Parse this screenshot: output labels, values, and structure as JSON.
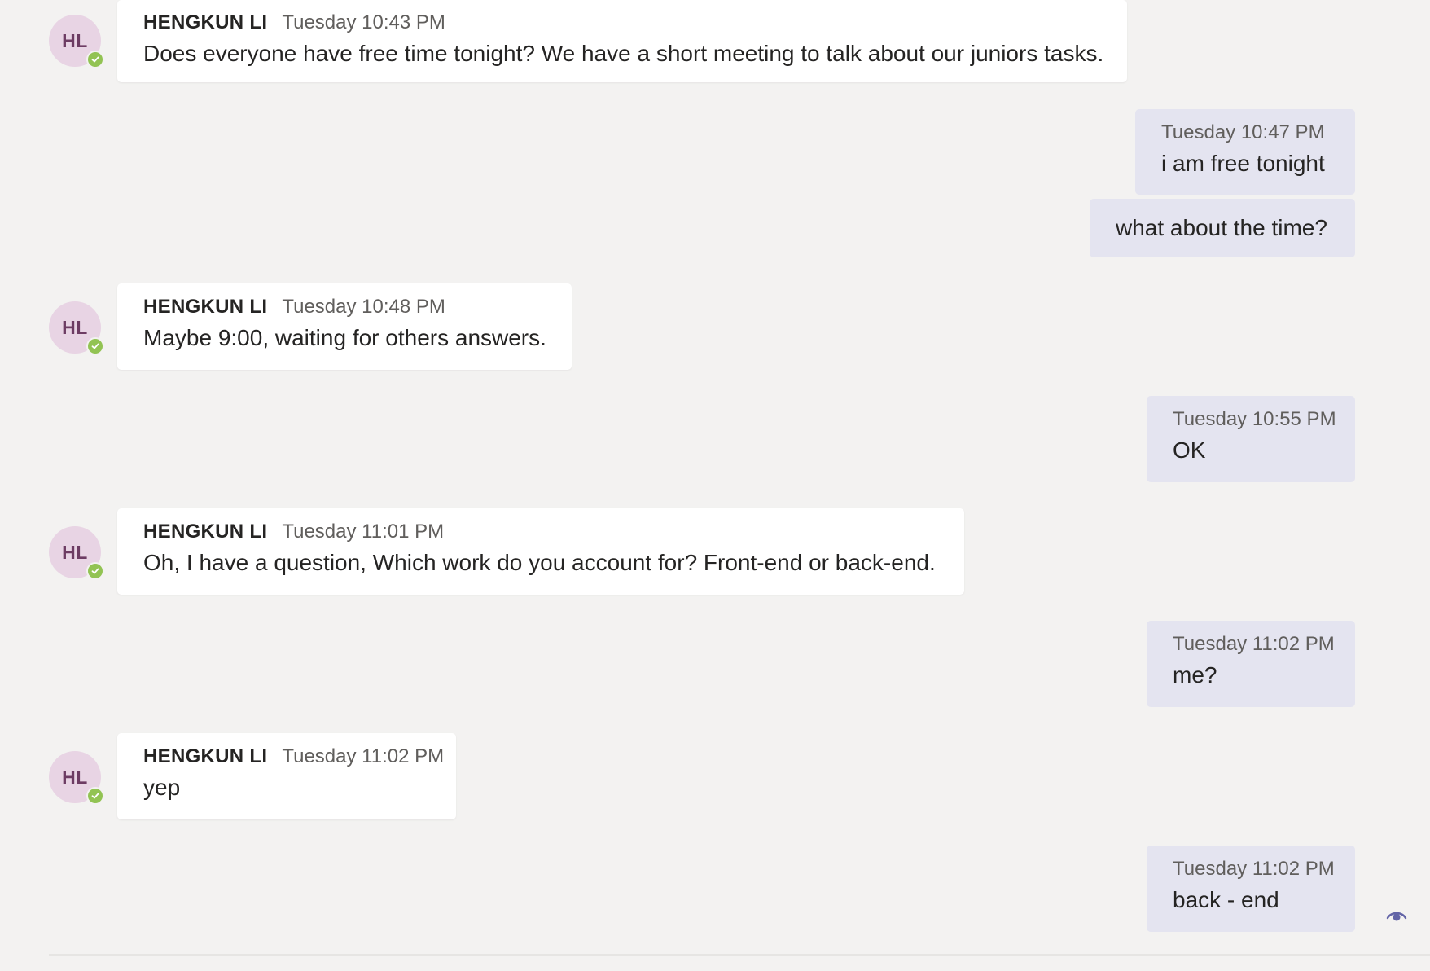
{
  "thread": {
    "messages": [
      {
        "direction": "incoming",
        "avatar_initials": "HL",
        "author": "HENGKUN LI",
        "time": "Tuesday 10:43 PM",
        "text": "Does everyone have free time tonight? We have a short meeting to talk about our juniors tasks."
      },
      {
        "direction": "outgoing",
        "time": "Tuesday 10:47 PM",
        "text": "i am free tonight"
      },
      {
        "direction": "outgoing",
        "time": "",
        "text": "what about the time?"
      },
      {
        "direction": "incoming",
        "avatar_initials": "HL",
        "author": "HENGKUN LI",
        "time": "Tuesday 10:48 PM",
        "text": "Maybe 9:00, waiting for others answers."
      },
      {
        "direction": "outgoing",
        "time": "Tuesday 10:55 PM",
        "text": "OK"
      },
      {
        "direction": "incoming",
        "avatar_initials": "HL",
        "author": "HENGKUN LI",
        "time": "Tuesday 11:01 PM",
        "text": "Oh, I have a question, Which work do you account for? Front-end or back-end."
      },
      {
        "direction": "outgoing",
        "time": "Tuesday 11:02 PM",
        "text": "me?"
      },
      {
        "direction": "incoming",
        "avatar_initials": "HL",
        "author": "HENGKUN LI",
        "time": "Tuesday 11:02 PM",
        "text": "yep"
      },
      {
        "direction": "outgoing",
        "time": "Tuesday 11:02 PM",
        "text": "back - end"
      }
    ],
    "status_icons": {
      "presence": "available-check-icon",
      "read_receipt": "seen-eye-icon"
    },
    "colors": {
      "background": "#f3f2f1",
      "incoming_bubble": "#ffffff",
      "outgoing_bubble": "#e4e4f0",
      "avatar_bg": "#e8d4e4",
      "avatar_text": "#6d3c63",
      "presence_available": "#92c353",
      "read_receipt": "#6264a7"
    }
  }
}
